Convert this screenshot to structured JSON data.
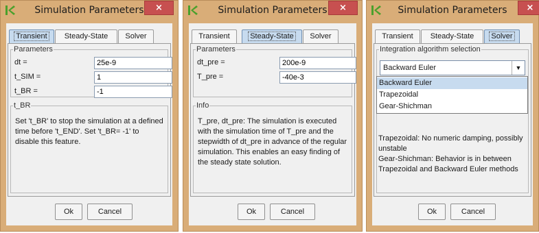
{
  "dialog_title": "Simulation Parameters",
  "close_glyph": "×",
  "tabs": {
    "transient": "Transient",
    "steady_state": "Steady-State",
    "solver": "Solver"
  },
  "buttons": {
    "ok": "Ok",
    "cancel": "Cancel"
  },
  "transient": {
    "parameters_legend": "Parameters",
    "fields": [
      {
        "label": "dt =",
        "value": "25e-9"
      },
      {
        "label": "t_SIM =",
        "value": "1"
      },
      {
        "label": "t_BR =",
        "value": "-1"
      }
    ],
    "info_legend": "t_BR",
    "info_text": "Set 't_BR' to stop the simulation at a defined time before 't_END'. Set 't_BR= -1' to disable this feature."
  },
  "steady_state": {
    "parameters_legend": "Parameters",
    "fields": [
      {
        "label": "dt_pre =",
        "value": "200e-9"
      },
      {
        "label": "T_pre =",
        "value": "-40e-3"
      }
    ],
    "info_legend": "Info",
    "info_text": "T_pre, dt_pre: The simulation is executed with the simulation time of T_pre and the stepwidth of dt_pre in advance of the regular simulation. This enables an easy finding of the steady state solution."
  },
  "solver": {
    "group_legend": "Integration algorithm selection",
    "selected": "Backward Euler",
    "options": [
      "Backward Euler",
      "Trapezoidal",
      "Gear-Shichman"
    ],
    "description": "Trapezoidal: No numeric damping, possibly unstable\nGear-Shichman: Behavior is in between Trapezoidal and Backward Euler methods"
  },
  "colors": {
    "frame": "#d9ad78",
    "close_button": "#c75050",
    "active_tab": "#c7dbef",
    "icon_green": "#4aa02c"
  },
  "icons": {
    "app": "app-logo-icon",
    "close": "close-icon",
    "dropdown": "chevron-down-icon"
  }
}
